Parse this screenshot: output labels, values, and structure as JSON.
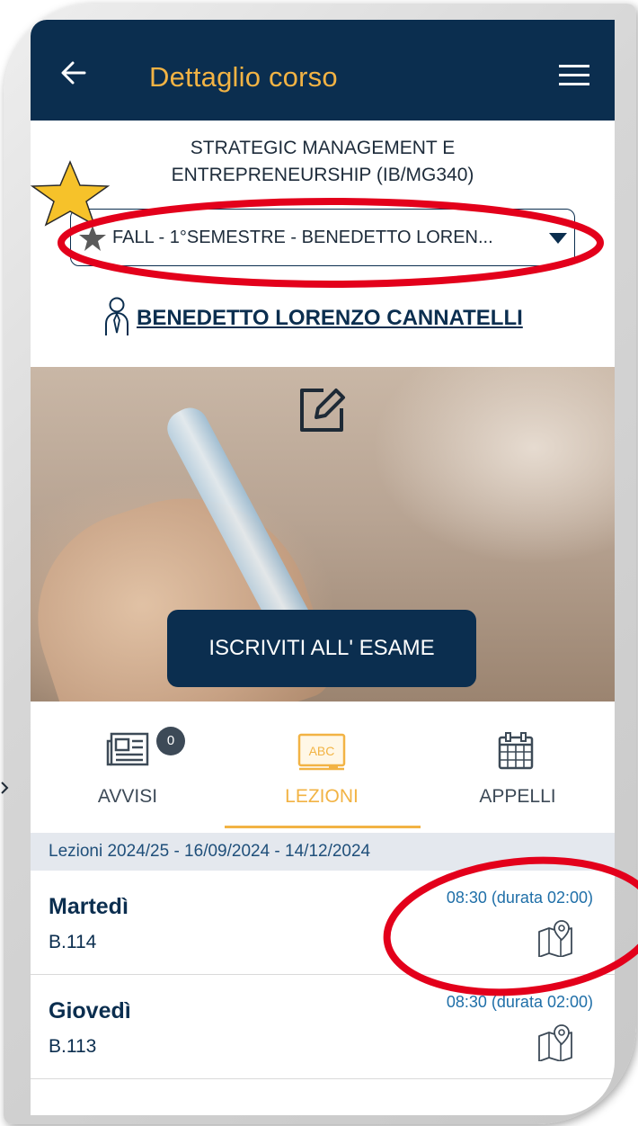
{
  "header": {
    "back_icon": "arrow-left-icon",
    "title": "Dettaglio corso",
    "menu_icon": "hamburger-menu-icon"
  },
  "course": {
    "title_line1": "STRATEGIC MANAGEMENT E",
    "title_line2": "ENTREPRENEURSHIP (IB/MG340)",
    "semester_selected": "FALL - 1°SEMESTRE - BENEDETTO LOREN...",
    "teacher": "BENEDETTO LORENZO CANNATELLI"
  },
  "hero": {
    "edit_icon": "edit-square-icon",
    "enroll_label": "ISCRIVITI ALL' ESAME"
  },
  "tabs": [
    {
      "label": "AVVISI",
      "icon": "newspaper-icon",
      "badge": "0",
      "active": false
    },
    {
      "label": "LEZIONI",
      "icon": "abc-board-icon",
      "active": true
    },
    {
      "label": "APPELLI",
      "icon": "calendar-icon",
      "active": false
    }
  ],
  "lessons": {
    "period": "Lezioni 2024/25 - 16/09/2024 - 14/12/2024",
    "items": [
      {
        "day": "Martedì",
        "room": "B.114",
        "time": "08:30 (durata 02:00)",
        "icon": "map-pin-icon"
      },
      {
        "day": "Giovedì",
        "room": "B.113",
        "time": "08:30 (durata 02:00)",
        "icon": "map-pin-icon"
      }
    ]
  },
  "colors": {
    "navy": "#0b2e4f",
    "accent": "#f2b344",
    "link_blue": "#1f6fa8",
    "annotation_red": "#e3001b",
    "annotation_star": "#f6c22a"
  }
}
